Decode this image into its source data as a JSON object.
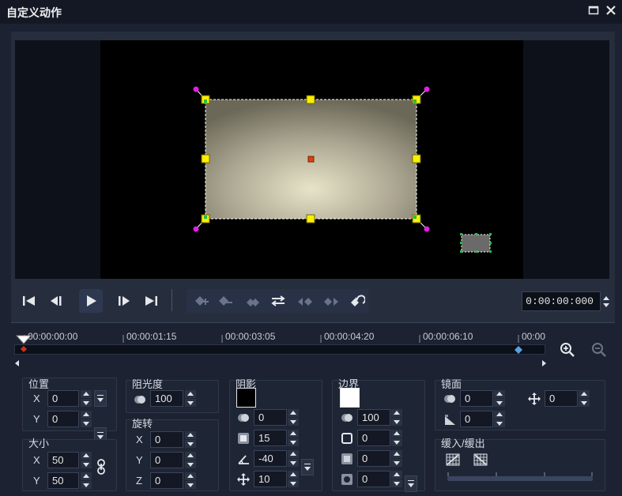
{
  "window": {
    "title": "自定义动作",
    "maximize_icon": "maximize-icon",
    "close_icon": "close-icon"
  },
  "transport": {
    "timecode": "0:00:00:000"
  },
  "timeline": {
    "ticks": [
      "00:00:00:00",
      "00:00:01:15",
      "00:00:03:05",
      "00:00:04:20",
      "00:00:06:10",
      "00:00"
    ]
  },
  "position": {
    "title": "位置",
    "x_label": "X",
    "x": "0",
    "y_label": "Y",
    "y": "0"
  },
  "size": {
    "title": "大小",
    "x_label": "X",
    "x": "50",
    "y_label": "Y",
    "y": "50"
  },
  "opacity": {
    "title": "阻光度",
    "value": "100"
  },
  "rotation": {
    "title": "旋转",
    "x_label": "X",
    "x": "0",
    "y_label": "Y",
    "y": "0",
    "z_label": "Z",
    "z": "0"
  },
  "shadow": {
    "title": "阴影",
    "color": "#000000",
    "opacity": "0",
    "blur": "15",
    "angle": "-40",
    "distance": "10"
  },
  "border": {
    "title": "边界",
    "color": "#ffffff",
    "opacity": "100",
    "width": "0",
    "v2": "0",
    "v3": "0"
  },
  "mirror": {
    "title": "镜面",
    "opacity": "0",
    "distance": "0",
    "fade": "0"
  },
  "fade_in_out": {
    "title": "缓入/缓出"
  },
  "colors": {
    "handle": "#ffee00",
    "rotate_handle": "#e020e0",
    "center": "#e04010",
    "corner_inner": "#20c040"
  }
}
